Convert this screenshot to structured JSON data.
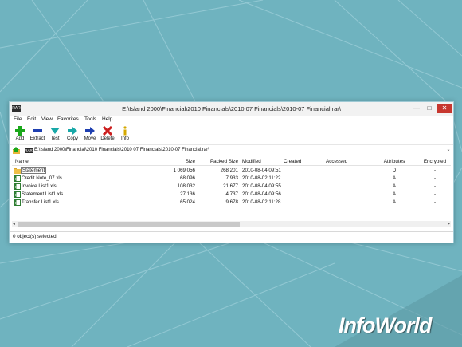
{
  "window": {
    "title": "E:\\Island 2000\\Financial\\2010 Financials\\2010 07 Financials\\2010-07 Financial.rar\\",
    "app_icon_text": "RAR",
    "controls": {
      "minimize": "—",
      "maximize": "□",
      "close": "✕"
    }
  },
  "menu": [
    "File",
    "Edit",
    "View",
    "Favorites",
    "Tools",
    "Help"
  ],
  "toolbar": [
    {
      "label": "Add",
      "icon": "plus-icon",
      "color": "#1aa71a"
    },
    {
      "label": "Extract",
      "icon": "minus-icon",
      "color": "#1e3fb0"
    },
    {
      "label": "Test",
      "icon": "check-arrow-icon",
      "color": "#18a8a8"
    },
    {
      "label": "Copy",
      "icon": "copy-arrow-icon",
      "color": "#18a8a8"
    },
    {
      "label": "Move",
      "icon": "move-arrow-icon",
      "color": "#1e3fb0"
    },
    {
      "label": "Delete",
      "icon": "delete-x-icon",
      "color": "#cc1f1f"
    },
    {
      "label": "Info",
      "icon": "info-icon",
      "color": "#d4a800"
    }
  ],
  "address": {
    "path": "E:\\Island 2000\\Financial\\2010 Financials\\2010 07 Financials\\2010-07 Financial.rar\\",
    "icon_text": "RAR"
  },
  "columns": [
    "Name",
    "Size",
    "Packed Size",
    "Modified",
    "Created",
    "Accessed",
    "Attributes",
    "Encrypted"
  ],
  "files": [
    {
      "name": "Statement",
      "icon": "folder-icon",
      "size": "1 069 056",
      "packed": "268 201",
      "modified": "2010-08-04 09:51",
      "created": "",
      "accessed": "",
      "attributes": "D",
      "encrypted": "-"
    },
    {
      "name": "Credit Note_07.xls",
      "icon": "excel-file-icon",
      "size": "68 096",
      "packed": "7 933",
      "modified": "2010-08-02 11:22",
      "created": "",
      "accessed": "",
      "attributes": "A",
      "encrypted": "-"
    },
    {
      "name": "Invoice List1.xls",
      "icon": "excel-file-icon",
      "size": "108 032",
      "packed": "21 677",
      "modified": "2010-08-04 09:55",
      "created": "",
      "accessed": "",
      "attributes": "A",
      "encrypted": "-"
    },
    {
      "name": "Statement List1.xls",
      "icon": "excel-file-icon",
      "size": "27 136",
      "packed": "4 737",
      "modified": "2010-08-04 09:56",
      "created": "",
      "accessed": "",
      "attributes": "A",
      "encrypted": "-"
    },
    {
      "name": "Transfer List1.xls",
      "icon": "excel-file-icon",
      "size": "65 024",
      "packed": "9 678",
      "modified": "2010-08-02 11:28",
      "created": "",
      "accessed": "",
      "attributes": "A",
      "encrypted": "-"
    }
  ],
  "status": "0 object(s) selected",
  "watermark": "InfoWorld",
  "colors": {
    "background": "#6fb3bf",
    "close_button": "#c7372f"
  }
}
